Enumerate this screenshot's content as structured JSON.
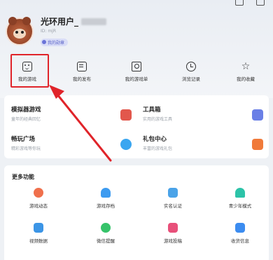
{
  "profile": {
    "username": "光环用户_",
    "user_id": "ID: mjR",
    "badge": "我的勋章"
  },
  "tabs": [
    {
      "label": "我的游戏",
      "icon": "gamepad-icon"
    },
    {
      "label": "我的发布",
      "icon": "publish-icon"
    },
    {
      "label": "我的游戏单",
      "icon": "game-list-icon"
    },
    {
      "label": "浏览记录",
      "icon": "clock-icon"
    },
    {
      "label": "我的收藏",
      "icon": "star-icon"
    }
  ],
  "services": [
    {
      "title": "模拟器游戏",
      "sub": "童年的经典回忆",
      "icon": "emulator-icon",
      "color": "#e2574c"
    },
    {
      "title": "工具箱",
      "sub": "实用的游戏工具",
      "icon": "toolbox-icon",
      "color": "#6a7fe6"
    },
    {
      "title": "畅玩广场",
      "sub": "精彩游戏等你玩",
      "icon": "play-square-icon",
      "color": "#3aa6f0"
    },
    {
      "title": "礼包中心",
      "sub": "丰富的游戏礼包",
      "icon": "gift-icon",
      "color": "#f07a3a"
    }
  ],
  "more": {
    "title": "更多功能",
    "items": [
      {
        "label": "游戏动态",
        "icon": "game-news-icon",
        "color": "#f0704c"
      },
      {
        "label": "游戏存档",
        "icon": "cloud-save-icon",
        "color": "#3d9bf0"
      },
      {
        "label": "实名认证",
        "icon": "id-verify-icon",
        "color": "#4aa3e8"
      },
      {
        "label": "青少年模式",
        "icon": "teen-mode-icon",
        "color": "#2cc3a8"
      },
      {
        "label": "视频数据",
        "icon": "video-data-icon",
        "color": "#3c95e6"
      },
      {
        "label": "微信提醒",
        "icon": "wechat-icon",
        "color": "#36c36a"
      },
      {
        "label": "游戏投稿",
        "icon": "submit-icon",
        "color": "#e8507a"
      },
      {
        "label": "收货信息",
        "icon": "address-icon",
        "color": "#3c8cf0"
      }
    ]
  },
  "accent": "#e0242a"
}
